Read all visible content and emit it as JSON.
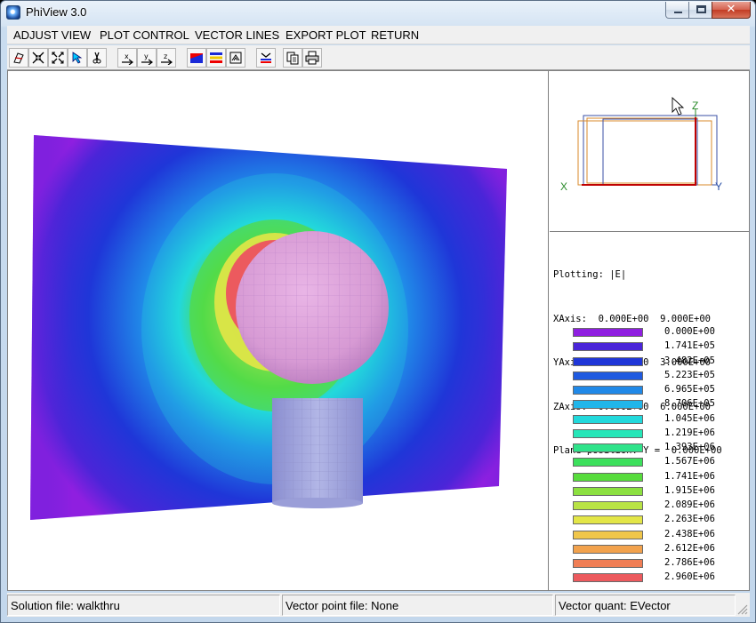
{
  "window": {
    "title": "PhiView 3.0"
  },
  "menu": [
    {
      "label": "ADJUST VIEW",
      "name": "menu-adjust-view"
    },
    {
      "label": "PLOT CONTROL",
      "name": "menu-plot-control"
    },
    {
      "label": "VECTOR LINES",
      "name": "menu-vector-lines"
    },
    {
      "label": "EXPORT PLOT",
      "name": "menu-export-plot"
    },
    {
      "label": "RETURN",
      "name": "menu-return"
    }
  ],
  "toolbar": [
    {
      "icon": "rotate-view-icon"
    },
    {
      "icon": "zoom-in-icon"
    },
    {
      "icon": "zoom-out-icon"
    },
    {
      "icon": "pointer-icon"
    },
    {
      "icon": "cut-icon"
    },
    {
      "icon": "view-x-axis-icon"
    },
    {
      "icon": "view-y-axis-icon"
    },
    {
      "icon": "view-z-axis-icon"
    },
    {
      "icon": "plot-style-icon"
    },
    {
      "icon": "color-bars-icon"
    },
    {
      "icon": "contour-icon"
    },
    {
      "icon": "vector-lines-icon"
    },
    {
      "icon": "copy-icon"
    },
    {
      "icon": "print-icon"
    }
  ],
  "orientation": {
    "x_label": "X",
    "y_label": "Y",
    "z_label": "Z"
  },
  "info": {
    "plotting": "Plotting: |E|",
    "xaxis": "XAxis:  0.000E+00  9.000E+00",
    "yaxis": "YAxis:  0.000E+00  3.000E+00",
    "zaxis": "ZAxis:  0.000E+00  6.000E+00",
    "plane": "Plane position: Y =  0.000E+00"
  },
  "legend": [
    {
      "label": "0.000E+00",
      "color": "#8f1fe0"
    },
    {
      "label": "1.741E+05",
      "color": "#4a25d8"
    },
    {
      "label": "3.482E+05",
      "color": "#1f36d8"
    },
    {
      "label": "5.223E+05",
      "color": "#1f5ae0"
    },
    {
      "label": "6.965E+05",
      "color": "#2089e8"
    },
    {
      "label": "8.706E+05",
      "color": "#21b6ea"
    },
    {
      "label": "1.045E+06",
      "color": "#22d9dc"
    },
    {
      "label": "1.219E+06",
      "color": "#25e6b8"
    },
    {
      "label": "1.393E+06",
      "color": "#2fe38a"
    },
    {
      "label": "1.567E+06",
      "color": "#3ce05c"
    },
    {
      "label": "1.741E+06",
      "color": "#57dc3c"
    },
    {
      "label": "1.915E+06",
      "color": "#8ce040"
    },
    {
      "label": "2.089E+06",
      "color": "#b9e345"
    },
    {
      "label": "2.263E+06",
      "color": "#e3e647"
    },
    {
      "label": "2.438E+06",
      "color": "#f0c64a"
    },
    {
      "label": "2.612E+06",
      "color": "#f2a24d"
    },
    {
      "label": "2.786E+06",
      "color": "#f07e55"
    },
    {
      "label": "2.960E+06",
      "color": "#ec5a5e"
    }
  ],
  "status": {
    "solution": "Solution file: walkthru",
    "vector_point": "Vector point file: None",
    "vector_quant": "Vector quant: EVector"
  }
}
